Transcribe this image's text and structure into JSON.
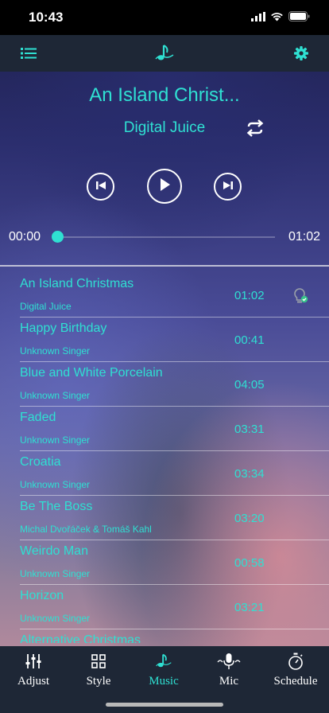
{
  "status": {
    "time": "10:43"
  },
  "colors": {
    "accent": "#2fe0d2",
    "bar": "#1e2736"
  },
  "nav": {
    "left_icon": "list-icon",
    "center_icon": "music-note-icon",
    "right_icon": "gear-icon"
  },
  "player": {
    "title": "An Island Christ...",
    "artist": "Digital Juice",
    "current_time": "00:00",
    "total_time": "01:02",
    "progress": 0,
    "icons": [
      "repeat-icon",
      "previous-icon",
      "play-icon",
      "next-icon"
    ]
  },
  "playlist": [
    {
      "title": "An Island Christmas",
      "artist": "Digital Juice",
      "duration": "01:02",
      "playing": true
    },
    {
      "title": "Happy Birthday",
      "artist": "Unknown Singer",
      "duration": "00:41"
    },
    {
      "title": "Blue and White Porcelain",
      "artist": "Unknown Singer",
      "duration": "04:05"
    },
    {
      "title": "Faded",
      "artist": "Unknown Singer",
      "duration": "03:31"
    },
    {
      "title": "Croatia",
      "artist": "Unknown Singer",
      "duration": "03:34"
    },
    {
      "title": "Be The Boss",
      "artist": "Michal Dvořáček & Tomáš Kahl",
      "duration": "03:20"
    },
    {
      "title": "Weirdo Man",
      "artist": "Unknown Singer",
      "duration": "00:58"
    },
    {
      "title": "Horizon",
      "artist": "Unknown Singer",
      "duration": "03:21"
    },
    {
      "title": "Alternative Christmas",
      "artist": "",
      "duration": ""
    }
  ],
  "tabs": [
    {
      "label": "Adjust",
      "icon": "sliders-icon"
    },
    {
      "label": "Style",
      "icon": "grid-icon"
    },
    {
      "label": "Music",
      "icon": "music-note-icon",
      "active": true
    },
    {
      "label": "Mic",
      "icon": "microphone-icon"
    },
    {
      "label": "Schedule",
      "icon": "timer-icon"
    }
  ]
}
